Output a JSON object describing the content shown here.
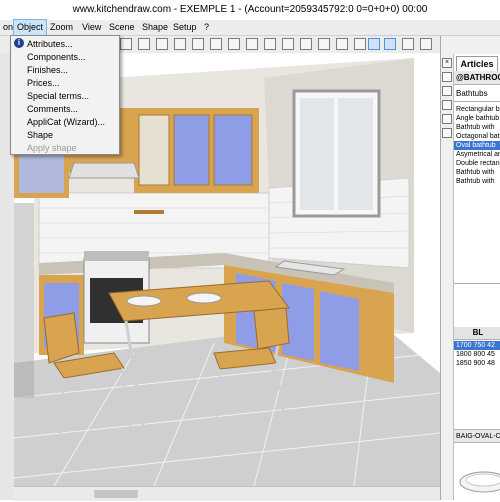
{
  "window": {
    "title": "www.kitchendraw.com - EXEMPLE 1 - (Account=2059345792:0 0=0+0+0) 00:00"
  },
  "menubar": {
    "items": [
      "on",
      "Object",
      "Zoom",
      "View",
      "Scene",
      "Shape",
      "Setup",
      "?"
    ],
    "active": "Object"
  },
  "object_menu": {
    "items": [
      "Attributes...",
      "Components...",
      "Finishes...",
      "Prices...",
      "Special terms...",
      "Comments...",
      "AppliCat (Wizard)...",
      "Shape",
      "Apply shape"
    ],
    "disabled": [
      "Apply shape"
    ]
  },
  "toolbar": {
    "icons": [
      "open-icon",
      "save-icon",
      "print-icon",
      "undo-icon",
      "redo-icon",
      "move-icon",
      "rotate-icon",
      "copy-icon",
      "delete-icon",
      "measure-icon",
      "zoom-in-icon",
      "zoom-out-icon",
      "zoom-all-icon",
      "plan-view-icon",
      "elevation-view-icon",
      "perspective-view-icon",
      "render-icon",
      "light-icon",
      "camera-icon",
      "sun-icon",
      "walk-icon",
      "settings-icon"
    ]
  },
  "right_panel": {
    "tab": "Articles",
    "catalog": "@BATHROOM",
    "category": "Bathtubs",
    "articles": [
      "Rectangular bathtub",
      "Angle bathtub",
      "Bathtub with",
      "Octagonal bathtub",
      "Oval bathtub",
      "Asymetrical angle",
      "Double rectangular",
      "Bathtub with",
      "Bathtub with"
    ],
    "selected_article": "Oval bathtub",
    "dimension_header": "BL",
    "dimensions": [
      "1700  750  42",
      "1800  800  45",
      "1850  900  48"
    ],
    "selected_dimension": "1700  750  42",
    "preview_ref": "BAIG-OVAL-C"
  },
  "colors": {
    "menu_highlight": "#cce4f7",
    "selection_blue": "#3b76d0",
    "cabinet_blue": "#7f8fe0",
    "wood": "#d9a450",
    "countertop": "#c9c2b6"
  }
}
